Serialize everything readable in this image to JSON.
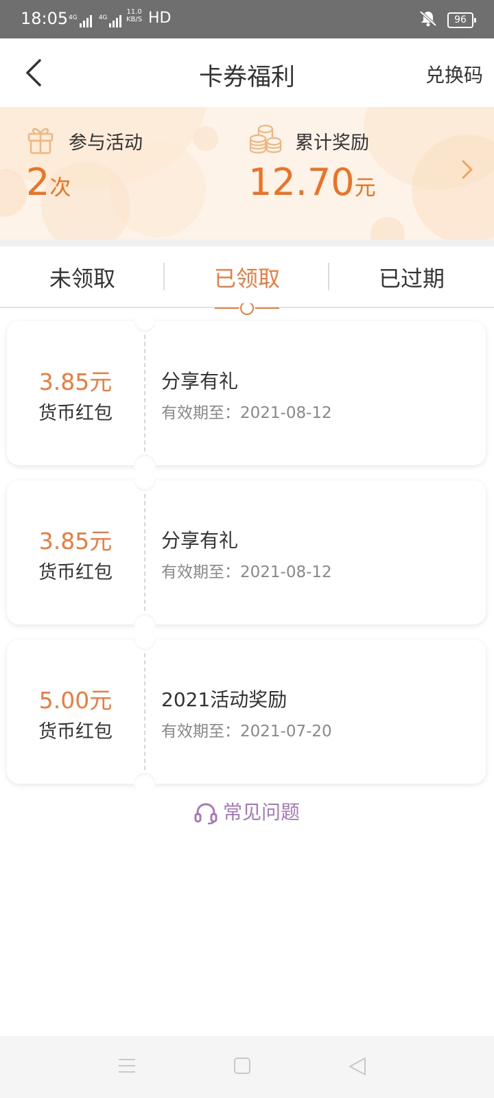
{
  "status_bar": {
    "time": "18:05",
    "network1": "4G",
    "network2": "4G",
    "speed_value": "11.0",
    "speed_unit": "KB/S",
    "hd": "HD",
    "battery": "96"
  },
  "nav": {
    "title": "卡券福利",
    "redeem_label": "兑换码",
    "back_icon": "chevron-left-icon"
  },
  "banner": {
    "participate": {
      "icon": "gift-icon",
      "label": "参与活动",
      "value": "2",
      "unit": "次"
    },
    "reward": {
      "icon": "coins-icon",
      "label": "累计奖励",
      "value": "12.70",
      "unit": "元"
    },
    "arrow_icon": "chevron-right-icon",
    "accent_color": "#ed7224"
  },
  "tabs": {
    "items": [
      {
        "label": "未领取",
        "active": false
      },
      {
        "label": "已领取",
        "active": true
      },
      {
        "label": "已过期",
        "active": false
      }
    ],
    "active_color": "#ee7a3c"
  },
  "coupons": [
    {
      "amount": "3.85元",
      "type": "货币红包",
      "title": "分享有礼",
      "expiry": "有效期至：2021-08-12"
    },
    {
      "amount": "3.85元",
      "type": "货币红包",
      "title": "分享有礼",
      "expiry": "有效期至：2021-08-12"
    },
    {
      "amount": "5.00元",
      "type": "货币红包",
      "title": "2021活动奖励",
      "expiry": "有效期至：2021-07-20"
    }
  ],
  "faq": {
    "label": "常见问题",
    "icon": "headset-icon",
    "color": "#a678b8"
  },
  "system_nav": {
    "menu_icon": "menu-icon",
    "home_icon": "home-square-icon",
    "back_icon": "back-triangle-icon"
  }
}
